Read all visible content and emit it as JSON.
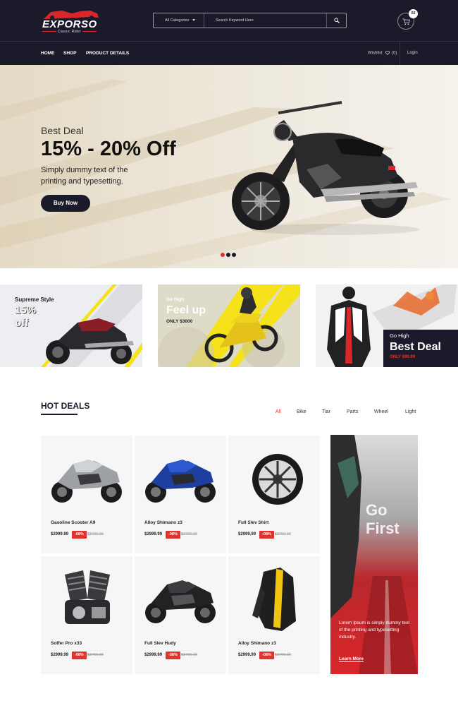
{
  "header": {
    "logo_text": "EXPORSO",
    "logo_tagline": "Classic Rider",
    "category_label": "All Categories",
    "search_placeholder": "Search Keyword Here",
    "cart_count": "02"
  },
  "nav": {
    "items": [
      {
        "label": "HOME"
      },
      {
        "label": "SHOP"
      },
      {
        "label": "PRODUCT DETAILS"
      }
    ],
    "wishlist_label": "Wishlist",
    "wishlist_count": "(0)",
    "login_label": "Login"
  },
  "hero": {
    "eyebrow": "Best Deal",
    "title": "15% - 20% Off",
    "text": "Simply dummy text of the printing and typesetting.",
    "button_label": "Buy Now",
    "slides": 3,
    "active_slide": 0
  },
  "banners": [
    {
      "title": "Supreme Style",
      "big": "15% off"
    },
    {
      "small": "Go High",
      "big": "Feel up",
      "note": "ONLY $3000"
    },
    {
      "small": "Go High",
      "big": "Best Deal",
      "note": "ONLY $99.99"
    }
  ],
  "hot_deals": {
    "title": "HOT DEALS",
    "tabs": [
      {
        "label": "All",
        "active": true
      },
      {
        "label": "Bike"
      },
      {
        "label": "Tiar"
      },
      {
        "label": "Parts"
      },
      {
        "label": "Wheel"
      },
      {
        "label": "Light"
      }
    ],
    "products": [
      {
        "name": "Gasoline Scooter A9",
        "price": "$2999.99",
        "discount": "-08%",
        "old_price": "$3700.00",
        "kind": "sportbike-silver"
      },
      {
        "name": "Alloy Shimano z3",
        "price": "$2999.99",
        "discount": "-08%",
        "old_price": "$3700.00",
        "kind": "sportbike-blue"
      },
      {
        "name": "Full Slev Shirt",
        "price": "$2999.99",
        "discount": "-08%",
        "old_price": "$3700.00",
        "kind": "wheel"
      },
      {
        "name": "Soffer Pro x33",
        "price": "$2999.99",
        "discount": "-08%",
        "old_price": "$3700.00",
        "kind": "engine"
      },
      {
        "name": "Full Slev Hudy",
        "price": "$2999.99",
        "discount": "-08%",
        "old_price": "$3700.00",
        "kind": "sportbike-black"
      },
      {
        "name": "Alloy Shimano z3",
        "price": "$2999.99",
        "discount": "-08%",
        "old_price": "$3700.00",
        "kind": "jacket"
      }
    ]
  },
  "promo": {
    "line1": "Go",
    "line2": "First",
    "text": "Lorem Ipsum is simply dummy text of the printing and typesetting industry.",
    "link_label": "Learn More"
  },
  "colors": {
    "dark": "#1b1a2b",
    "accent": "#e0322f",
    "yellow": "#f5e21b"
  }
}
